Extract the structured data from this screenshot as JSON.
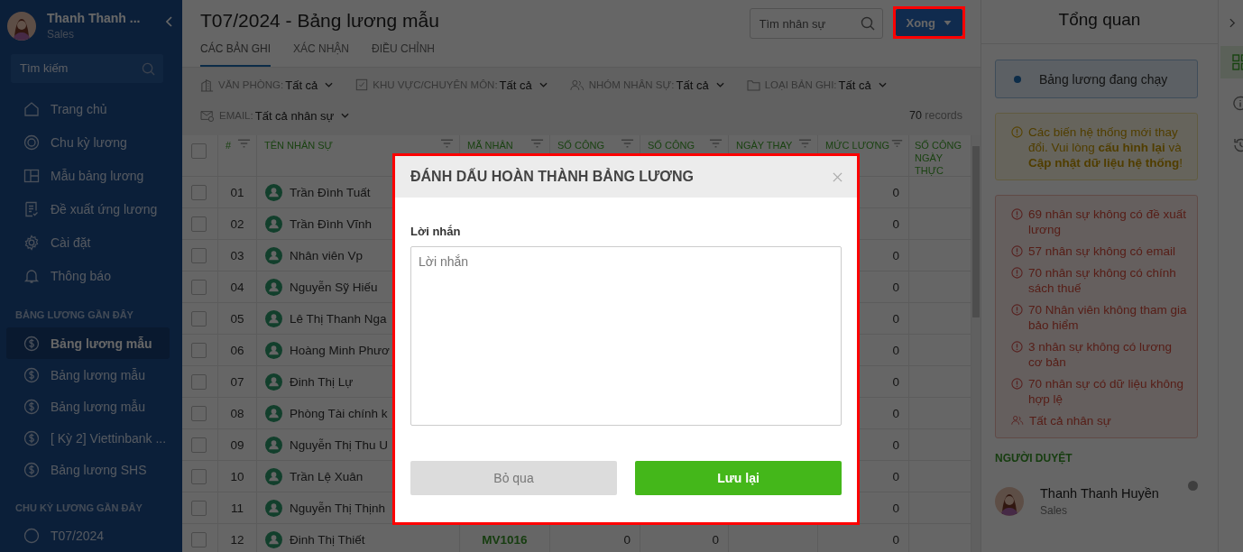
{
  "sidebar": {
    "user": {
      "name": "Thanh Thanh ...",
      "role": "Sales"
    },
    "search": {
      "placeholder": "Tìm kiếm"
    },
    "nav": [
      {
        "label": "Trang chủ",
        "kind": "home"
      },
      {
        "label": "Chu kỳ lương",
        "kind": "cycle"
      },
      {
        "label": "Mẫu bảng lương",
        "kind": "template"
      },
      {
        "label": "Đề xuất ứng lương",
        "kind": "proposal"
      },
      {
        "label": "Cài đặt",
        "kind": "settings"
      },
      {
        "label": "Thông báo",
        "kind": "bell"
      }
    ],
    "recent_payrolls": {
      "title": "BẢNG LƯƠNG GẦN ĐÂY",
      "items": [
        {
          "label": "Bảng lương mẫu",
          "selected": true
        },
        {
          "label": "Bảng lương mẫu",
          "selected": false
        },
        {
          "label": "Bảng lương mẫu",
          "selected": false
        },
        {
          "label": "[ Kỳ 2] Viettinbank ...",
          "selected": false
        },
        {
          "label": "Bảng lương SHS",
          "selected": false
        }
      ]
    },
    "recent_cycles": {
      "title": "CHU KỲ LƯƠNG GẦN ĐÂY",
      "items": [
        {
          "label": "T07/2024"
        }
      ]
    }
  },
  "header": {
    "title": "T07/2024 - Bảng lương mẫu",
    "tabs": [
      {
        "label": "CÁC BẢN GHI",
        "selected": true
      },
      {
        "label": "XÁC NHẬN",
        "selected": false
      },
      {
        "label": "ĐIỀU CHỈNH",
        "selected": false
      }
    ],
    "search": {
      "placeholder": "Tìm nhân sự"
    },
    "done_button": {
      "label": "Xong",
      "highlighted": true
    }
  },
  "filters": [
    {
      "kind": "office",
      "label": "VĂN PHÒNG:",
      "value": "Tất cả"
    },
    {
      "kind": "area",
      "label": "KHU VỰC/CHUYÊN MÔN:",
      "value": "Tất cả"
    },
    {
      "kind": "group",
      "label": "NHÓM NHÂN SỰ:",
      "value": "Tất cả"
    },
    {
      "kind": "folder",
      "label": "LOẠI BẢN GHI:",
      "value": "Tất cả"
    },
    {
      "kind": "email",
      "label": "EMAIL:",
      "value": "Tất cả nhân sự"
    }
  ],
  "records": {
    "count": "70",
    "unit": "records"
  },
  "table": {
    "all_checked": false,
    "columns": [
      {
        "label": "#",
        "filter": true
      },
      {
        "label": "TÊN NHÂN SỰ",
        "filter": true
      },
      {
        "label": "MÃ NHÂN",
        "filter": true
      },
      {
        "label": "SỐ CÔNG",
        "filter": true
      },
      {
        "label": "SỐ CÔNG",
        "filter": true
      },
      {
        "label": "NGÀY THAY",
        "filter": true
      },
      {
        "label": "MỨC LƯƠNG",
        "filter": true
      },
      {
        "label": "SỐ CÔNG NGÀY THỰC",
        "filter": false
      }
    ],
    "rows": [
      {
        "checked": false,
        "no": "01",
        "name": "Trần Đình Tuất",
        "salary": "0"
      },
      {
        "checked": false,
        "no": "02",
        "name": "Trần Đình Vĩnh",
        "salary": "0"
      },
      {
        "checked": false,
        "no": "03",
        "name": "Nhân viên Vp",
        "salary": "0"
      },
      {
        "checked": false,
        "no": "04",
        "name": "Nguyễn Sỹ Hiếu",
        "salary": "0"
      },
      {
        "checked": false,
        "no": "05",
        "name": "Lê Thị Thanh Nga",
        "salary": "0"
      },
      {
        "checked": false,
        "no": "06",
        "name": "Hoàng Minh Phươ",
        "salary": "0"
      },
      {
        "checked": false,
        "no": "07",
        "name": "Đinh Thị Lự",
        "salary": "0"
      },
      {
        "checked": false,
        "no": "08",
        "name": "Phòng Tài chính k",
        "salary": "0"
      },
      {
        "checked": false,
        "no": "09",
        "name": "Nguyễn Thị Thu U",
        "salary": "0"
      },
      {
        "checked": false,
        "no": "10",
        "name": "Trần Lệ Xuân",
        "salary": "0"
      },
      {
        "checked": false,
        "no": "11",
        "name": "Nguyễn Thị Thịnh",
        "salary": "0"
      },
      {
        "checked": false,
        "no": "12",
        "name": "Đinh Thị Thiết",
        "code": "MV1016",
        "work_1": "0",
        "work_2": "0",
        "salary": "0"
      }
    ]
  },
  "overview": {
    "title": "Tổng quan",
    "status": {
      "label": "Bảng lương đang chạy"
    },
    "notice": "Các biến hệ thống mới thay đổi. Vui lòng **cấu hình lại** và **Cập nhật dữ liệu hệ thống**!",
    "warnings": [
      {
        "kind": "warning",
        "text": "69 nhân sự không có đề xuất lương"
      },
      {
        "kind": "warning",
        "text": "57 nhân sự không có email"
      },
      {
        "kind": "warning",
        "text": "70 nhân sự không có chính sách thuế"
      },
      {
        "kind": "warning",
        "text": "70 Nhân viên không tham gia bảo hiểm"
      },
      {
        "kind": "warning",
        "text": "3 nhân sự không có lương cơ bản"
      },
      {
        "kind": "warning",
        "text": "70 nhân sự có dữ liệu không hợp lệ"
      },
      {
        "kind": "people",
        "text": "Tất cả nhân sự"
      }
    ],
    "reviewers_title": "NGƯỜI DUYỆT",
    "reviewers": [
      {
        "name": "Thanh Thanh Huyền",
        "role": "Sales"
      }
    ]
  },
  "rail": [
    {
      "kind": "grid",
      "selected": true
    },
    {
      "kind": "info",
      "selected": false
    },
    {
      "kind": "history",
      "selected": false
    }
  ],
  "modal": {
    "title": "ĐÁNH DẤU HOÀN THÀNH BẢNG LƯƠNG",
    "highlighted": true,
    "field_label": "Lời nhắn",
    "placeholder": "Lời nhắn",
    "cancel": "Bỏ qua",
    "save": "Lưu lại"
  }
}
